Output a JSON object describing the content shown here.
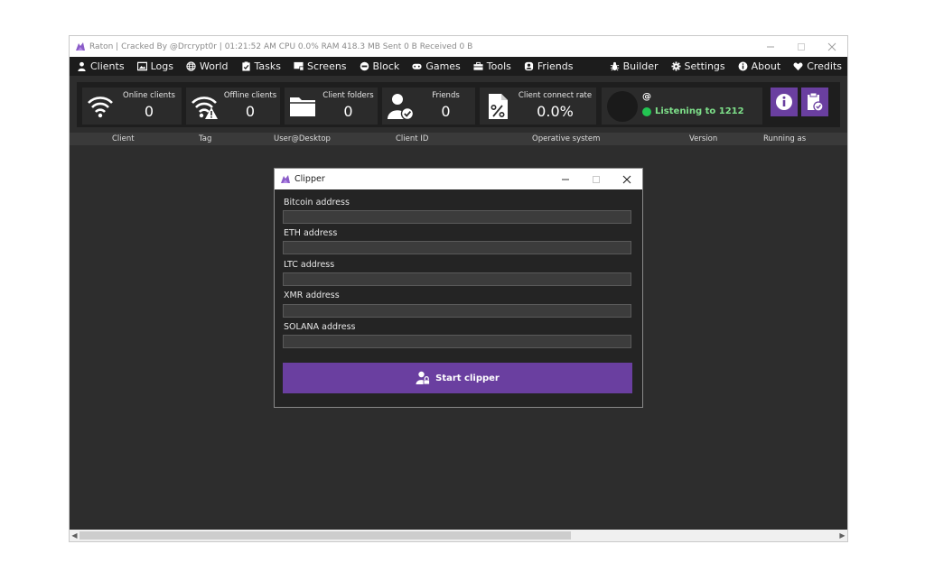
{
  "window": {
    "title": "Raton | Cracked By @Drcrypt0r | 01:21:52 AM CPU 0.0% RAM 418.3 MB Sent 0 B Received 0 B"
  },
  "menu": {
    "left": [
      {
        "label": "Clients",
        "icon": "user-icon"
      },
      {
        "label": "Logs",
        "icon": "image-icon"
      },
      {
        "label": "World",
        "icon": "globe-icon"
      },
      {
        "label": "Tasks",
        "icon": "clipboard-check-icon"
      },
      {
        "label": "Screens",
        "icon": "screen-icon"
      },
      {
        "label": "Block",
        "icon": "block-icon"
      },
      {
        "label": "Games",
        "icon": "gamepad-icon"
      },
      {
        "label": "Tools",
        "icon": "toolbox-icon"
      },
      {
        "label": "Friends",
        "icon": "friends-icon"
      }
    ],
    "right": [
      {
        "label": "Builder",
        "icon": "bug-icon"
      },
      {
        "label": "Settings",
        "icon": "gear-icon"
      },
      {
        "label": "About",
        "icon": "info-icon"
      },
      {
        "label": "Credits",
        "icon": "heart-icon"
      }
    ]
  },
  "stats": [
    {
      "label": "Online clients",
      "value": "0",
      "icon": "wifi-icon"
    },
    {
      "label": "Offline clients",
      "value": "0",
      "icon": "wifi-warning-icon"
    },
    {
      "label": "Client folders",
      "value": "0",
      "icon": "folder-icon"
    },
    {
      "label": "Friends",
      "value": "0",
      "icon": "user-check-icon"
    },
    {
      "label": "Client connect rate",
      "value": "0.0%",
      "icon": "percent-file-icon"
    }
  ],
  "listener": {
    "at": "@",
    "status": "Listening to 1212",
    "status_color": "#23c552"
  },
  "columns": [
    "Client",
    "Tag",
    "User@Desktop",
    "Client ID",
    "Operative system",
    "Version",
    "Running as"
  ],
  "dialog": {
    "title": "Clipper",
    "fields": [
      {
        "label": "Bitcoin address",
        "value": ""
      },
      {
        "label": "ETH address",
        "value": ""
      },
      {
        "label": "LTC address",
        "value": ""
      },
      {
        "label": "XMR address",
        "value": ""
      },
      {
        "label": "SOLANA address",
        "value": ""
      }
    ],
    "start_label": "Start clipper"
  },
  "colors": {
    "accent": "#6a3fa0",
    "background": "#2d2d2d",
    "menubar": "#1c1c1c"
  }
}
